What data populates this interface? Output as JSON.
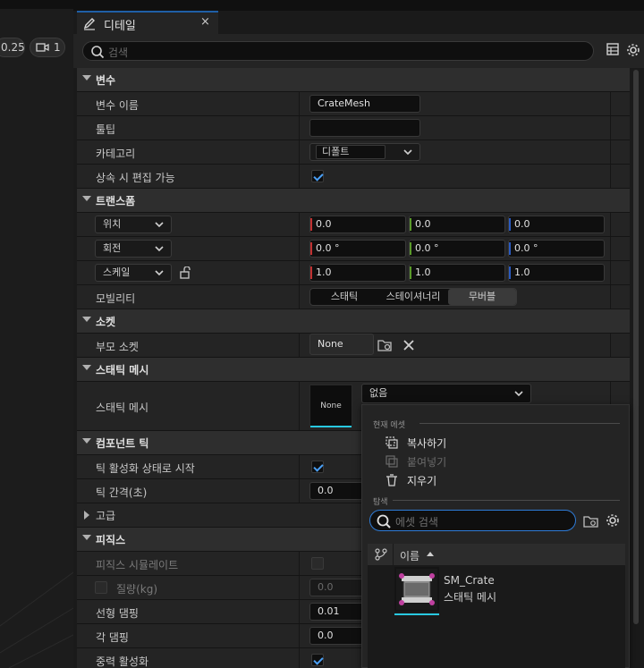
{
  "viewport": {
    "zoom_label": "0.25",
    "camera_speed": "1"
  },
  "tab": {
    "title": "디테일",
    "close": "×"
  },
  "search": {
    "placeholder": "검색"
  },
  "sections": {
    "variables": {
      "title": "변수",
      "name_label": "변수 이름",
      "name_value": "CrateMesh",
      "tooltip_label": "툴팁",
      "tooltip_value": "",
      "category_label": "카테고리",
      "category_value": "디폴트",
      "editable_label": "상속 시 편집 가능",
      "editable_checked": true
    },
    "transform": {
      "title": "트랜스폼",
      "location_label": "위치",
      "location": [
        "0.0",
        "0.0",
        "0.0"
      ],
      "rotation_label": "회전",
      "rotation": [
        "0.0 °",
        "0.0 °",
        "0.0 °"
      ],
      "scale_label": "스케일",
      "scale": [
        "1.0",
        "1.0",
        "1.0"
      ],
      "mobility_label": "모빌리티",
      "mobility_options": [
        "스태틱",
        "스테이셔너리",
        "무버블"
      ],
      "mobility_selected": "무버블"
    },
    "sockets": {
      "title": "소켓",
      "parent_label": "부모 소켓",
      "parent_value": "None"
    },
    "static_mesh": {
      "title": "스태틱 메시",
      "mesh_label": "스태틱 메시",
      "thumb_label": "None",
      "dropdown_value": "없음"
    },
    "component_tick": {
      "title": "컴포넌트 틱",
      "start_label": "틱 활성화 상태로 시작",
      "start_checked": true,
      "interval_label": "틱 간격(초)",
      "interval_value": "0.0"
    },
    "advanced": {
      "title": "고급"
    },
    "physics": {
      "title": "피직스",
      "simulate_label": "피직스 시뮬레이트",
      "mass_label": "질량(kg)",
      "mass_value": "0.0",
      "linear_damping_label": "선형 댐핑",
      "linear_damping_value": "0.01",
      "angular_damping_label": "각 댐핑",
      "angular_damping_value": "0.0",
      "gravity_label": "중력 활성화",
      "gravity_checked": true
    }
  },
  "popup": {
    "current_asset_header": "현재 에셋",
    "copy_label": "복사하기",
    "paste_label": "붙여넣기",
    "clear_label": "지우기",
    "browse_header": "탐색",
    "search_placeholder": "에셋 검색",
    "column_name": "이름",
    "asset": {
      "name": "SM_Crate",
      "type": "스태틱 메시"
    }
  },
  "colors": {
    "accent": "#2e7bd6",
    "check": "#4a9ff5",
    "thumb_bar": "#28c8e0"
  }
}
